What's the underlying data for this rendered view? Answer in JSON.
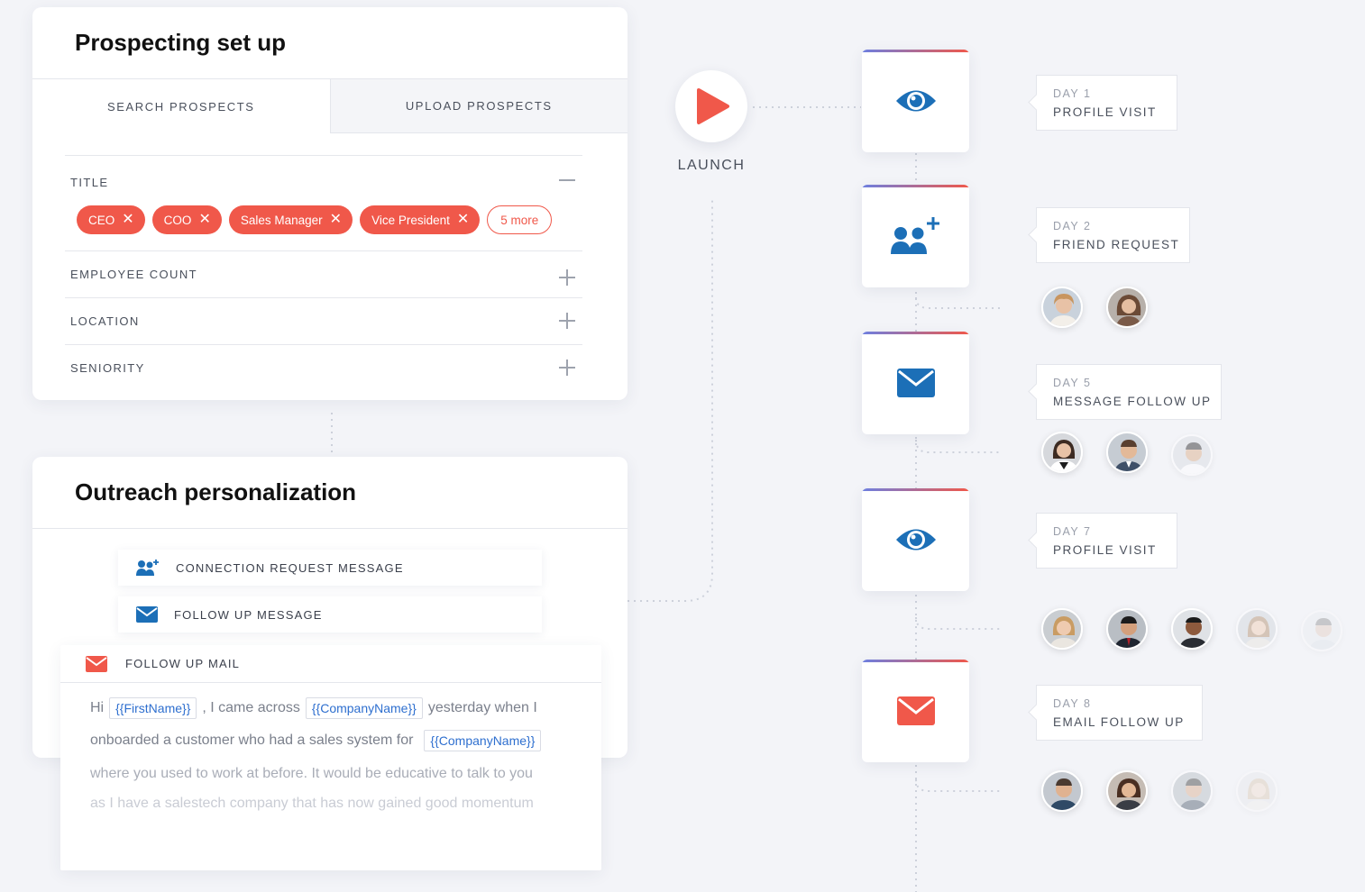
{
  "prospecting": {
    "title": "Prospecting set up",
    "tabs": [
      "SEARCH PROSPECTS",
      "UPLOAD PROSPECTS"
    ],
    "filters": {
      "title_label": "TITLE",
      "chips": [
        "CEO",
        "COO",
        "Sales Manager",
        "Vice President"
      ],
      "chip_remove_glyph": "✕",
      "more_label": "5 more",
      "employee_count_label": "EMPLOYEE COUNT",
      "location_label": "LOCATION",
      "seniority_label": "SENIORITY"
    }
  },
  "outreach": {
    "title": "Outreach personalization",
    "connection_label": "CONNECTION REQUEST MESSAGE",
    "follow_up_label": "FOLLOW UP MESSAGE",
    "mail_label": "FOLLOW UP MAIL",
    "mail": {
      "hi": "Hi",
      "var_firstname": "{{FirstName}}",
      "after_firstname": ", I came across",
      "var_company": "{{CompanyName}}",
      "after_company": "yesterday when I",
      "line2_text": "onboarded a customer who had a sales system for",
      "line3": "where you used to work at before. It would be educative to talk to you",
      "line4": "as I have a salestech company that has now gained good momentum"
    }
  },
  "launch": {
    "label": "LAUNCH"
  },
  "steps": [
    {
      "icon": "eye-icon",
      "day": "DAY 1",
      "action": "PROFILE VISIT"
    },
    {
      "icon": "add-users-icon",
      "day": "DAY 2",
      "action": "FRIEND REQUEST"
    },
    {
      "icon": "envelope-icon",
      "day": "DAY 5",
      "action": "MESSAGE FOLLOW UP"
    },
    {
      "icon": "eye-icon",
      "day": "DAY 7",
      "action": "PROFILE VISIT"
    },
    {
      "icon": "mail-icon",
      "day": "DAY 8",
      "action": "EMAIL FOLLOW UP"
    }
  ],
  "colors": {
    "accent_red": "#f0584a",
    "accent_blue": "#1c6fb7",
    "gradient_start": "#6d7fe0",
    "background": "#f3f4f8"
  }
}
